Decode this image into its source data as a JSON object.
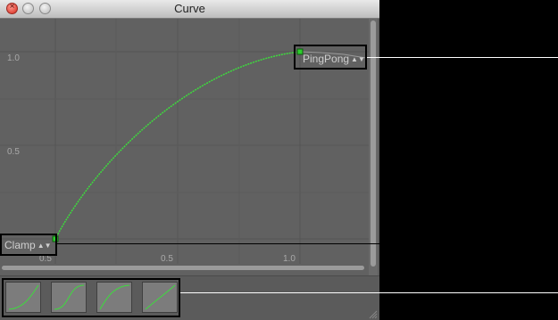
{
  "window": {
    "title": "Curve"
  },
  "axis": {
    "y_ticks": [
      "1.0",
      "0.5"
    ],
    "x_ticks": [
      "0.5",
      "0.5",
      "1.0"
    ]
  },
  "wrap_modes": {
    "pre": "Clamp",
    "post": "PingPong"
  },
  "icons": {
    "close": "close-icon",
    "minimize": "minimize-icon",
    "zoom": "zoom-icon",
    "updown": "up-down-arrows-icon",
    "grip": "resize-grip-icon"
  },
  "colors": {
    "curve": "#3ddc3d",
    "key": "#2ecc2e"
  },
  "presets": [
    "ease-in-preset",
    "s-curve-preset",
    "ease-out-preset",
    "linear-preset"
  ]
}
